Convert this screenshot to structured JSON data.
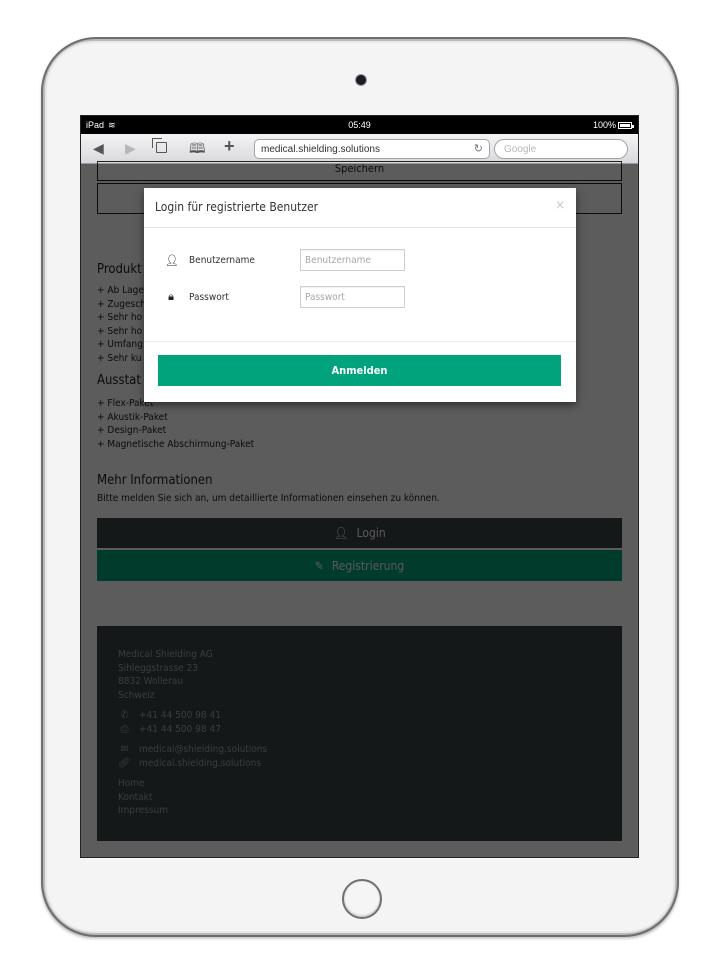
{
  "device": {
    "name": "iPad"
  },
  "statusbar": {
    "carrier": "iPad",
    "time": "05:49",
    "battery": "100%"
  },
  "browser": {
    "url": "medical.shielding.solutions",
    "search_placeholder": "Google",
    "icons": {
      "back": "◀",
      "forward": "▶",
      "bookmarks": "🕮",
      "new_tab": "+",
      "reload": "↻"
    }
  },
  "page": {
    "top_button_label": "Speichern",
    "produkt_heading": "Produkt",
    "produkt_items": [
      "Ab Lage",
      "Zugesch",
      "Sehr ho",
      "Sehr ho",
      "Umfang",
      "Sehr ku"
    ],
    "ausstattung_heading": "Ausstat",
    "ausstattung_items": [
      "Flex-Paket",
      "Akustik-Paket",
      "Design-Paket",
      "Magnetische Abschirmung-Paket"
    ],
    "mehr_info_heading": "Mehr Informationen",
    "mehr_info_text": "Bitte melden Sie sich an, um detaillierte Informationen einsehen zu können.",
    "login_button": "Login",
    "register_button": "Registrierung",
    "colors": {
      "accent": "#00a37b",
      "dark": "#3c4446"
    }
  },
  "footer": {
    "company": "Medical Shielding AG",
    "street": "Sihleggstrasse 23",
    "city": "8832 Wollerau",
    "country": "Schweiz",
    "phone": "+41 44 500 98 41",
    "fax": "+41 44 500 98 47",
    "email": "medical@shielding.solutions",
    "website": "medical.shielding.solutions",
    "links": [
      "Home",
      "Kontakt",
      "Impressum"
    ]
  },
  "modal": {
    "title": "Login für registrierte Benutzer",
    "close": "×",
    "username_label": "Benutzername",
    "username_placeholder": "Benutzername",
    "username_value": "",
    "password_label": "Passwort",
    "password_placeholder": "Passwort",
    "password_value": "",
    "submit_label": "Anmelden"
  }
}
